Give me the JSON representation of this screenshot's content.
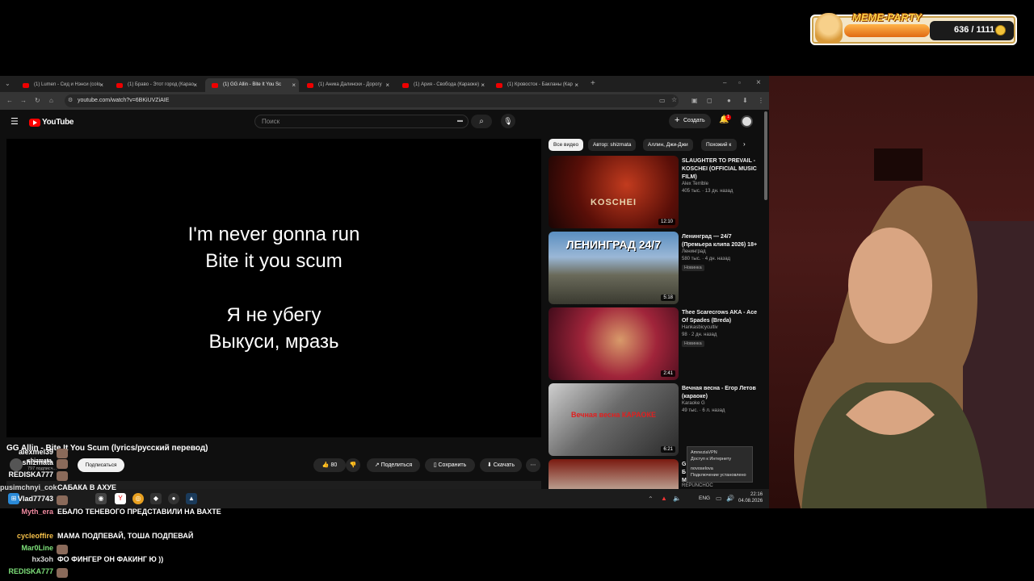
{
  "overlay": {
    "widget_title": "MEME-PARTY",
    "counter": "636 / 1111"
  },
  "browser": {
    "tabs": [
      {
        "label": "(1) Lumen - Сид и Нэнси (colo"
      },
      {
        "label": "(1) Браво - Этот город (Карао"
      },
      {
        "label": "(1) GG Allin - Bite It You Sc"
      },
      {
        "label": "(1) Аника Далински - Дорогу"
      },
      {
        "label": "(1) Ария - Свобода (Караоке)"
      },
      {
        "label": "(1) Кровосток - Бакланы (Кар"
      }
    ],
    "url": "youtube.com/watch?v=6BKiUVZiAIE"
  },
  "youtube": {
    "logo_text": "YouTube",
    "search_placeholder": "Поиск",
    "create_label": "Создать",
    "notification_count": "1",
    "lyrics": [
      "I'm never gonna run",
      "Bite it you scum",
      "Я не убегу",
      "Выкуси, мразь"
    ],
    "video_title": "GG Allin - Bite It You Scum (lyrics/русский перевод)",
    "channel_name": "shizmata",
    "subscribers": "797 подписч...",
    "subscribe_label": "Подписаться",
    "like_count": "80",
    "share_label": "Поделиться",
    "save_label": "Сохранить",
    "download_label": "Скачать",
    "chips": [
      "Все видео",
      "Автор: shizmata",
      "Аллин, Джи-Джи",
      "Похожий к"
    ],
    "recommendations": [
      {
        "title": "SLAUGHTER TO PREVAIL - KOSCHEI (OFFICIAL MUSIC FILM)",
        "channel": "Alex Terrible",
        "meta": "405 тыс. · 13 дн. назад",
        "duration": "12:10",
        "thumb_text": "KOSCHEI",
        "badge": ""
      },
      {
        "title": "Ленинград — 24/7 (Премьера клипа 2026) 18+",
        "channel": "Ленинград",
        "meta": "580 тыс. · 4 дн. назад",
        "duration": "5:18",
        "thumb_text": "ЛЕНИНГРАД 24/7",
        "badge": "Новинка"
      },
      {
        "title": "Thee Scarecrows AKA - Ace Of Spades (Breda)",
        "channel": "Hankasbicycultiv",
        "meta": "98 · 2 дн. назад",
        "duration": "2:41",
        "thumb_text": "",
        "badge": "Новинка"
      },
      {
        "title": "Вечная весна - Егор Летов (караоке)",
        "channel": "Karaoke G",
        "meta": "49 тыс. · 6 л. назад",
        "duration": "6:21",
        "thumb_text": "Вечная весна КАРАОКЕ",
        "badge": ""
      }
    ],
    "rec5_partial": [
      "G",
      "Б",
      "М",
      "REPUNCHOC"
    ]
  },
  "vpn_tooltip": {
    "lines": [
      "AmneziaVPN",
      "Доступ к Интернету",
      "",
      "novoselova",
      "Подключение установлено"
    ]
  },
  "taskbar": {
    "lang": "ENG",
    "time": "22:16",
    "date": "04.08.2026"
  },
  "chat": [
    {
      "name": "alexmel39",
      "message": "",
      "color": "#ffffff"
    },
    {
      "name": "shizmata",
      "message": "",
      "color": "#ffffff"
    },
    {
      "name": "REDISKA777",
      "message": "",
      "color": "#ffffff"
    },
    {
      "name": "pusimchnyi_cok",
      "message": "САБАКА В АХУЕ",
      "color": "#d9d9d9"
    },
    {
      "name": "Vlad77743",
      "message": "",
      "color": "#ffffff"
    },
    {
      "name": "Myth_era",
      "message": "ЕБАЛО ТЕНЕВОГО ПРЕДСТАВИЛИ НА ВАХТЕ",
      "color": "#f08aa0"
    },
    {
      "name": "cycleoffire",
      "message": "МАМА ПОДПЕВАЙ, ТОША ПОДПЕВАЙ",
      "color": "#f5c04a"
    },
    {
      "name": "Mar0Line",
      "message": "",
      "color": "#7ee07a"
    },
    {
      "name": "hx3oh",
      "message": "ФО ФИНГЕР ОН ФАКИНГ Ю ))",
      "color": "#d9d9d9"
    },
    {
      "name": "REDISKA777",
      "message": "",
      "color": "#7ee07a"
    }
  ],
  "colors": {
    "youtube_red": "#ff0000",
    "yt_bg": "#0f0f0f",
    "chip_bg": "#272727"
  }
}
